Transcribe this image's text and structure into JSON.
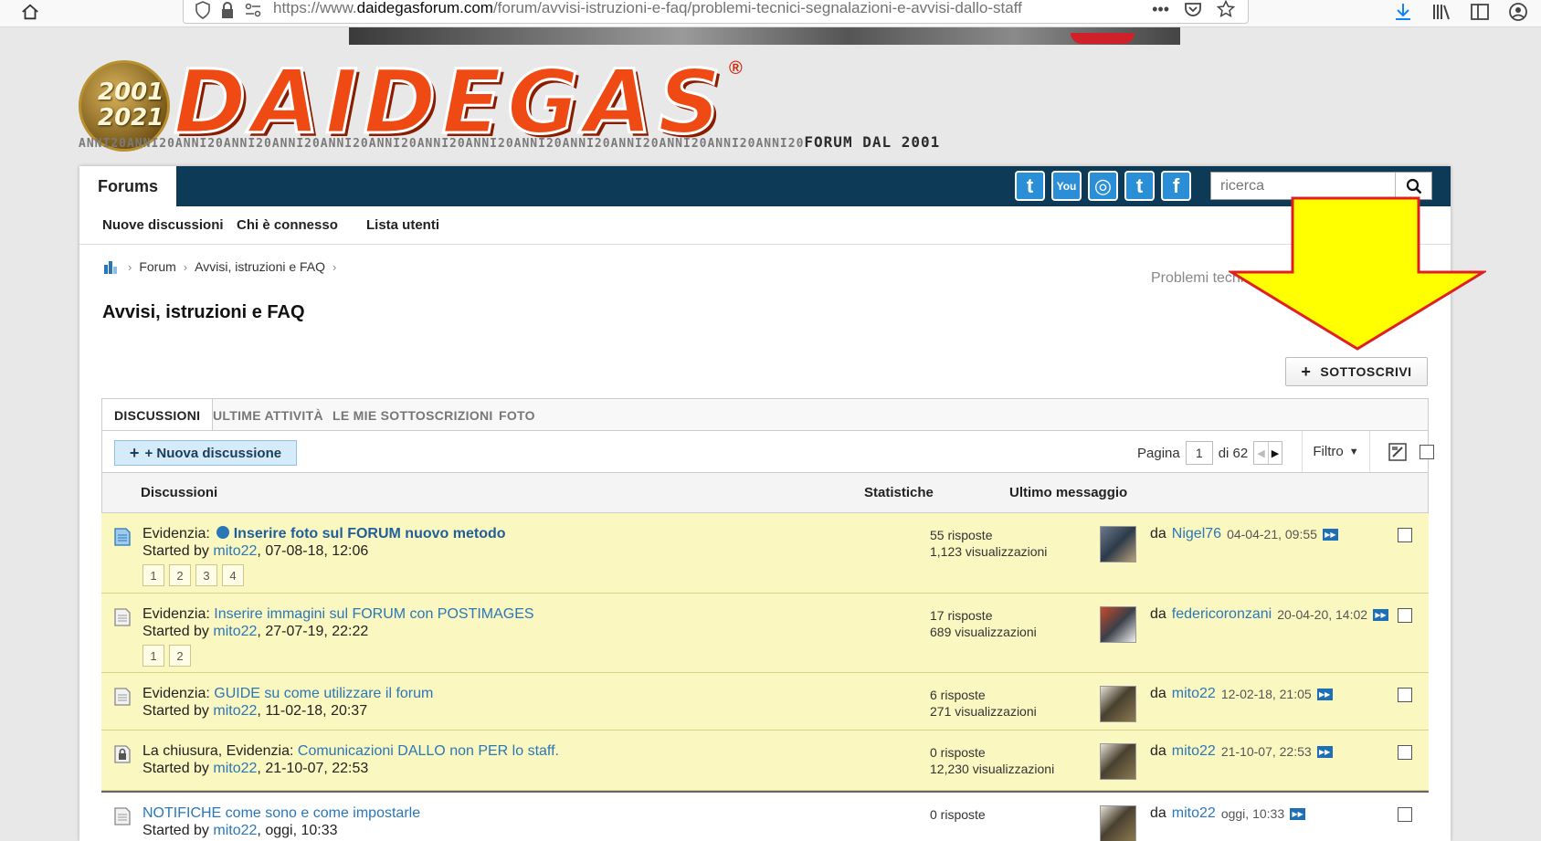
{
  "browser": {
    "url_prefix": "https://www.",
    "url_domain": "daidegasforum.com",
    "url_path": "/forum/avvisi-istruzioni-e-faq/problemi-tecnici-segnalazioni-e-avvisi-dallo-staff",
    "menu_dots": "•••"
  },
  "logo": {
    "medal_line1": "2001",
    "medal_line2": "2021",
    "wordmark": "DAIDEGAS",
    "registered": "®",
    "tagline": "ANNI20ANNI20ANNI20ANNI20ANNI20ANNI20ANNI20ANNI20ANNI20ANNI20ANNI20ANNI20ANNI20ANNI20ANNI20",
    "tagline_end": "FORUM DAL 2001"
  },
  "nav": {
    "forums_tab": "Forums",
    "social": [
      "twitter-icon",
      "youtube-icon",
      "instagram-icon",
      "tumblr-icon",
      "facebook-icon"
    ],
    "social_glyphs": {
      "twitter": "t",
      "youtube": "You",
      "instagram": "◎",
      "tumblr": "t",
      "facebook": "f"
    },
    "search_placeholder": "ricerca",
    "sub_links": [
      "Nuove discussioni",
      "Chi è connesso",
      "Lista utenti"
    ]
  },
  "breadcrumb": [
    "Forum",
    "Avvisi, istruzioni e FAQ",
    "Problemi tecnici, segnalazioni e avvisi dallo staff"
  ],
  "page_title": "Avvisi, istruzioni e FAQ",
  "subscribe_label": "SOTTOSCRIVI",
  "tabs": [
    "DISCUSSIONI",
    "ULTIME ATTIVITÀ",
    "LE MIE SOTTOSCRIZIONI",
    "FOTO"
  ],
  "toolbar": {
    "new_thread_label": "+ Nuova discussione",
    "page_label": "Pagina",
    "page_value": "1",
    "page_total": "di 62",
    "filter_label": "Filtro"
  },
  "table_headers": {
    "discussions": "Discussioni",
    "stats": "Statistiche",
    "last_post": "Ultimo messaggio"
  },
  "threads": [
    {
      "prefix": "Evidenzia:",
      "title": "Inserire foto sul FORUM nuovo metodo",
      "started_by": "Started by",
      "author": "mito22",
      "date": ", 07-08-18, 12:06",
      "pages": [
        "1",
        "2",
        "3",
        "4"
      ],
      "replies": "55 risposte",
      "views": "1,123 visualizzazioni",
      "last_prefix": "da",
      "last_user": "Nigel76",
      "last_date": "04-04-21, 09:55"
    },
    {
      "prefix": "Evidenzia:",
      "title": "Inserire immagini sul FORUM con POSTIMAGES",
      "started_by": "Started by",
      "author": "mito22",
      "date": ", 27-07-19, 22:22",
      "pages": [
        "1",
        "2"
      ],
      "replies": "17 risposte",
      "views": "689 visualizzazioni",
      "last_prefix": "da",
      "last_user": "federicoronzani",
      "last_date": "20-04-20, 14:02"
    },
    {
      "prefix": "Evidenzia:",
      "title": "GUIDE su come utilizzare il forum",
      "started_by": "Started by",
      "author": "mito22",
      "date": ", 11-02-18, 20:37",
      "pages": [],
      "replies": "6 risposte",
      "views": "271 visualizzazioni",
      "last_prefix": "da",
      "last_user": "mito22",
      "last_date": "12-02-18, 21:05"
    },
    {
      "prefix": "La chiusura, Evidenzia:",
      "title": "Comunicazioni DALLO non PER lo staff.",
      "started_by": "Started by",
      "author": "mito22",
      "date": ", 21-10-07, 22:53",
      "pages": [],
      "replies": "0 risposte",
      "views": "12,230 visualizzazioni",
      "last_prefix": "da",
      "last_user": "mito22",
      "last_date": "21-10-07, 22:53"
    },
    {
      "prefix": "",
      "title": "NOTIFICHE come sono e come impostarle",
      "started_by": "Started by",
      "author": "mito22",
      "date": ", oggi, 10:33",
      "pages": [],
      "replies": "0 risposte",
      "views": "",
      "last_prefix": "da",
      "last_user": "mito22",
      "last_date": "oggi, 10:33"
    }
  ],
  "colors": {
    "nav_bg": "#0d3a56",
    "sticky_bg": "#fbf7c1",
    "link": "#2a77b8",
    "arrow_fill": "#ffff00",
    "arrow_stroke": "#e02020"
  }
}
